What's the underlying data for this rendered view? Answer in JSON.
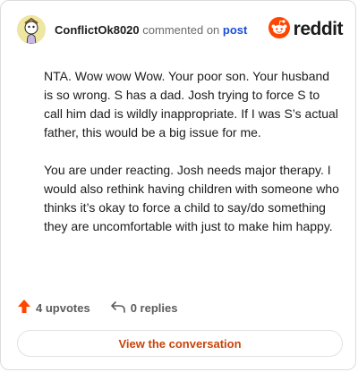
{
  "comment": {
    "username": "ConflictOk8020",
    "action": "commented on",
    "post_link": "post",
    "paragraphs": [
      "NTA. Wow wow Wow. Your poor son. Your husband is so wrong. S has a dad. Josh trying to force S to call him dad is wildly inappropriate. If I was S’s actual father, this would be a big issue for me.",
      "You are under reacting. Josh needs major therapy. I would also rethink having children with someone who thinks it’s okay to force a child to say/do something they are uncomfortable with just to make him happy."
    ]
  },
  "brand": {
    "name": "reddit",
    "accent": "#ff4500"
  },
  "footer": {
    "upvotes": "4 upvotes",
    "replies": "0 replies"
  },
  "cta": {
    "label": "View the conversation"
  },
  "icons": {
    "avatar": "snoo-avatar-icon",
    "logo": "reddit-logo-icon",
    "upvote": "upvote-arrow-icon",
    "reply": "reply-arrow-icon"
  },
  "colors": {
    "link": "#1a4fd6",
    "cta_text": "#c9430a",
    "upvote": "#ff4500"
  }
}
